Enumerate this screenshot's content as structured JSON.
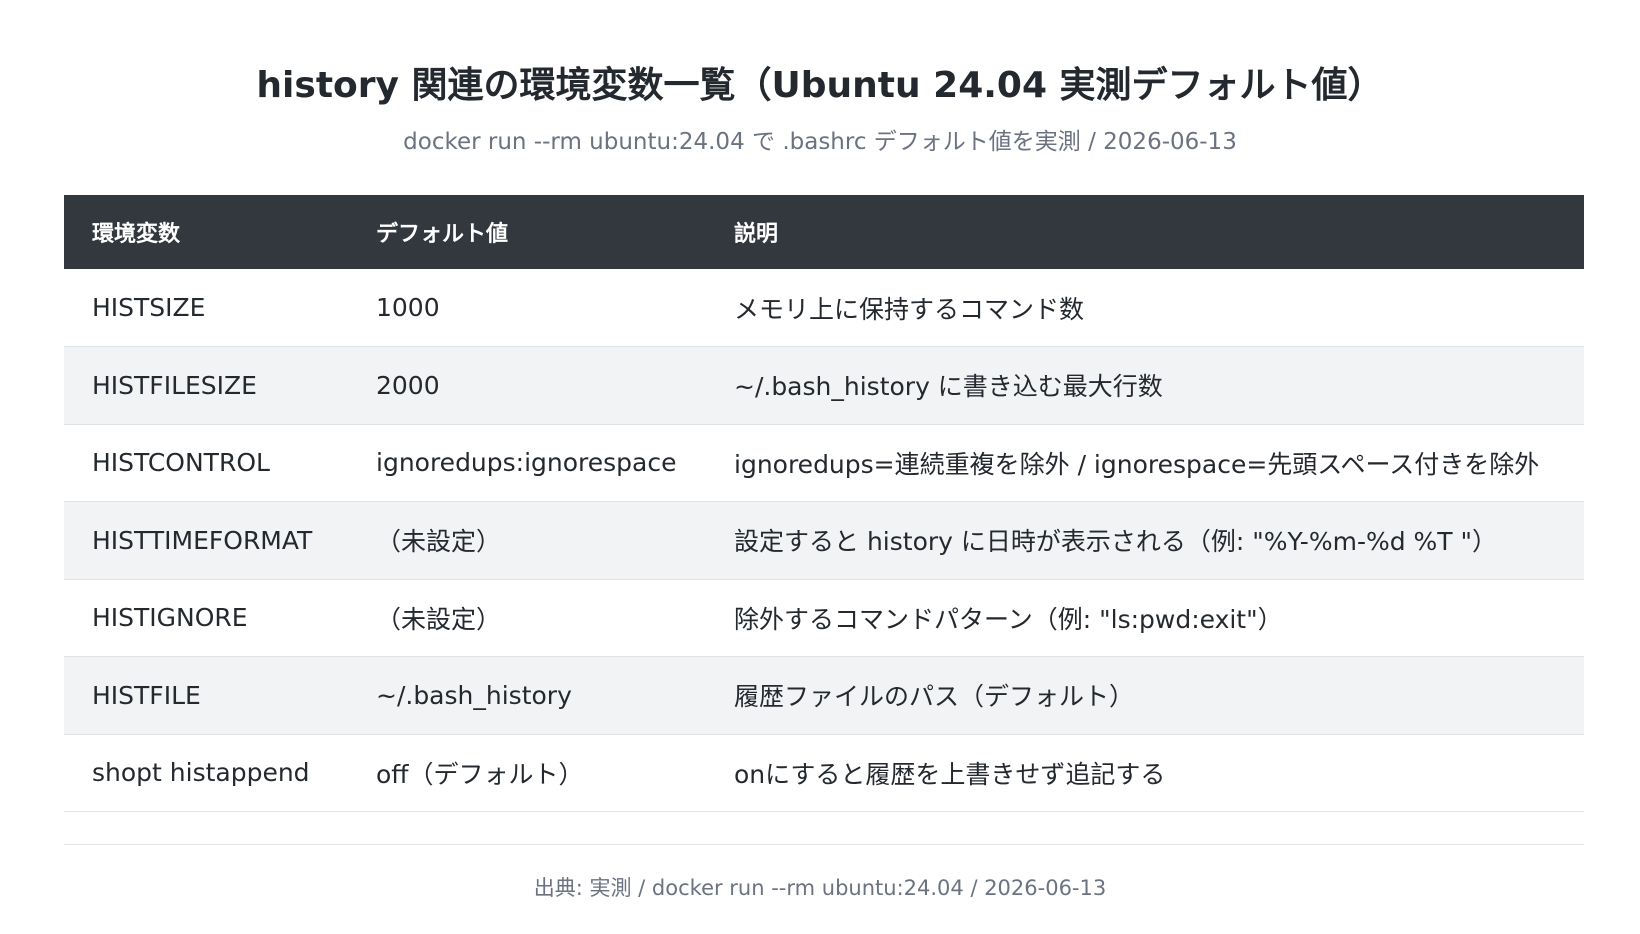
{
  "title": "history 関連の環境変数一覧（Ubuntu 24.04 実測デフォルト値）",
  "subtitle": "docker run --rm ubuntu:24.04 で .bashrc デフォルト値を実測 / 2026-06-13",
  "table": {
    "headers": [
      "環境変数",
      "デフォルト値",
      "説明"
    ],
    "rows": [
      [
        "HISTSIZE",
        "1000",
        "メモリ上に保持するコマンド数"
      ],
      [
        "HISTFILESIZE",
        "2000",
        "~/.bash_history に書き込む最大行数"
      ],
      [
        "HISTCONTROL",
        "ignoredups:ignorespace",
        "ignoredups=連続重複を除外 / ignorespace=先頭スペース付きを除外"
      ],
      [
        "HISTTIMEFORMAT",
        "（未設定）",
        "設定すると history に日時が表示される（例: \"%Y-%m-%d %T \"）"
      ],
      [
        "HISTIGNORE",
        "（未設定）",
        "除外するコマンドパターン（例: \"ls:pwd:exit\"）"
      ],
      [
        "HISTFILE",
        "~/.bash_history",
        "履歴ファイルのパス（デフォルト）"
      ],
      [
        "shopt histappend",
        "off（デフォルト）",
        "onにすると履歴を上書きせず追記する"
      ]
    ]
  },
  "footer": "出典: 実測 / docker run --rm ubuntu:24.04 / 2026-06-13"
}
